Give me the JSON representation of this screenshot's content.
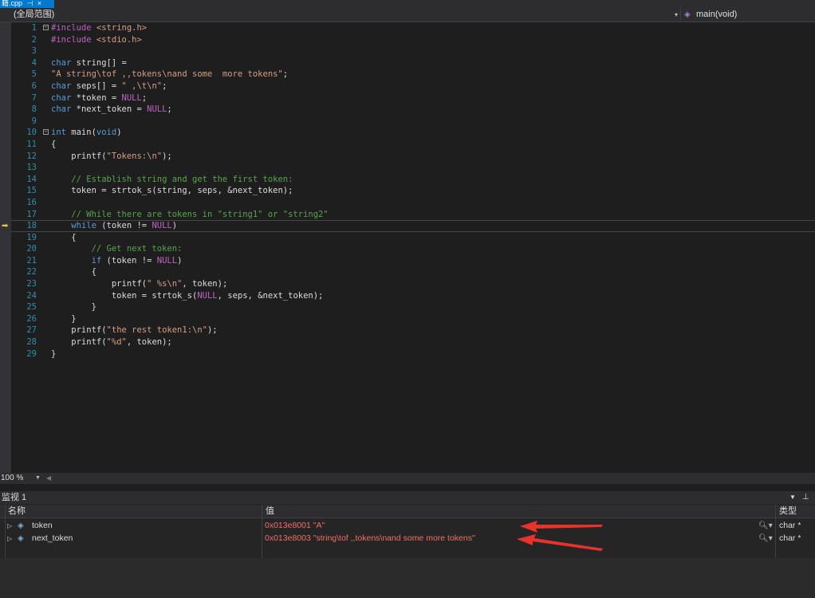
{
  "tab": {
    "label": "籍.cpp",
    "pin": "⊣",
    "close": "×"
  },
  "navbar": {
    "scope": "(全局范围)",
    "member": "main(void)"
  },
  "code": [
    {
      "n": "1",
      "fold": "−",
      "parts": [
        {
          "c": "mac",
          "t": "#include "
        },
        {
          "c": "str",
          "t": "<string.h>"
        }
      ]
    },
    {
      "n": "2",
      "parts": [
        {
          "c": "mac",
          "t": "#include "
        },
        {
          "c": "str",
          "t": "<stdio.h>"
        }
      ]
    },
    {
      "n": "3",
      "parts": []
    },
    {
      "n": "4",
      "parts": [
        {
          "c": "kw",
          "t": "char"
        },
        {
          "c": "",
          "t": " string[] ="
        }
      ]
    },
    {
      "n": "5",
      "parts": [
        {
          "c": "str",
          "t": "\"A string\\tof ,,tokens\\nand some  more tokens\""
        },
        {
          "c": "",
          "t": ";"
        }
      ]
    },
    {
      "n": "6",
      "parts": [
        {
          "c": "kw",
          "t": "char"
        },
        {
          "c": "",
          "t": " seps[] = "
        },
        {
          "c": "str",
          "t": "\" ,\\t\\n\""
        },
        {
          "c": "",
          "t": ";"
        }
      ]
    },
    {
      "n": "7",
      "parts": [
        {
          "c": "kw",
          "t": "char"
        },
        {
          "c": "",
          "t": " *token = "
        },
        {
          "c": "mac",
          "t": "NULL"
        },
        {
          "c": "",
          "t": ";"
        }
      ]
    },
    {
      "n": "8",
      "parts": [
        {
          "c": "kw",
          "t": "char"
        },
        {
          "c": "",
          "t": " *next_token = "
        },
        {
          "c": "mac",
          "t": "NULL"
        },
        {
          "c": "",
          "t": ";"
        }
      ]
    },
    {
      "n": "9",
      "parts": []
    },
    {
      "n": "10",
      "fold": "−",
      "parts": [
        {
          "c": "kw",
          "t": "int"
        },
        {
          "c": "",
          "t": " main("
        },
        {
          "c": "kw",
          "t": "void"
        },
        {
          "c": "",
          "t": ")"
        }
      ]
    },
    {
      "n": "11",
      "parts": [
        {
          "c": "",
          "t": "{"
        }
      ]
    },
    {
      "n": "12",
      "parts": [
        {
          "c": "",
          "t": "    printf("
        },
        {
          "c": "str",
          "t": "\"Tokens:\\n\""
        },
        {
          "c": "",
          "t": ");"
        }
      ]
    },
    {
      "n": "13",
      "parts": []
    },
    {
      "n": "14",
      "parts": [
        {
          "c": "cm",
          "t": "    // Establish string and get the first token:"
        }
      ]
    },
    {
      "n": "15",
      "parts": [
        {
          "c": "",
          "t": "    token = strtok_s(string, seps, &next_token);"
        }
      ]
    },
    {
      "n": "16",
      "parts": []
    },
    {
      "n": "17",
      "parts": [
        {
          "c": "cm",
          "t": "    // While there are tokens in \"string1\" or \"string2\""
        }
      ]
    },
    {
      "n": "18",
      "current": true,
      "parts": [
        {
          "c": "",
          "t": "    "
        },
        {
          "c": "kw",
          "t": "while"
        },
        {
          "c": "",
          "t": " (token != "
        },
        {
          "c": "mac",
          "t": "NULL"
        },
        {
          "c": "",
          "t": ")"
        }
      ]
    },
    {
      "n": "19",
      "parts": [
        {
          "c": "",
          "t": "    {"
        }
      ]
    },
    {
      "n": "20",
      "parts": [
        {
          "c": "cm",
          "t": "        // Get next token:"
        }
      ]
    },
    {
      "n": "21",
      "parts": [
        {
          "c": "",
          "t": "        "
        },
        {
          "c": "kw",
          "t": "if"
        },
        {
          "c": "",
          "t": " (token != "
        },
        {
          "c": "mac",
          "t": "NULL"
        },
        {
          "c": "",
          "t": ")"
        }
      ]
    },
    {
      "n": "22",
      "parts": [
        {
          "c": "",
          "t": "        {"
        }
      ]
    },
    {
      "n": "23",
      "parts": [
        {
          "c": "",
          "t": "            printf("
        },
        {
          "c": "str",
          "t": "\" %s\\n\""
        },
        {
          "c": "",
          "t": ", token);"
        }
      ]
    },
    {
      "n": "24",
      "parts": [
        {
          "c": "",
          "t": "            token = strtok_s("
        },
        {
          "c": "mac",
          "t": "NULL"
        },
        {
          "c": "",
          "t": ", seps, &next_token);"
        }
      ]
    },
    {
      "n": "25",
      "parts": [
        {
          "c": "",
          "t": "        }"
        }
      ]
    },
    {
      "n": "26",
      "parts": [
        {
          "c": "",
          "t": "    }"
        }
      ]
    },
    {
      "n": "27",
      "parts": [
        {
          "c": "",
          "t": "    printf("
        },
        {
          "c": "str",
          "t": "\"the rest token1:\\n\""
        },
        {
          "c": "",
          "t": ");"
        }
      ]
    },
    {
      "n": "28",
      "parts": [
        {
          "c": "",
          "t": "    printf("
        },
        {
          "c": "str",
          "t": "\"%d\""
        },
        {
          "c": "",
          "t": ", token);"
        }
      ]
    },
    {
      "n": "29",
      "parts": [
        {
          "c": "",
          "t": "}"
        }
      ]
    }
  ],
  "zoom": {
    "value": "100 %"
  },
  "watch": {
    "title": "监视 1",
    "headers": {
      "name": "名称",
      "value": "值",
      "type": "类型"
    },
    "rows": [
      {
        "name": "token",
        "value": "0x013e8001 \"A\"",
        "type": "char *"
      },
      {
        "name": "next_token",
        "value": "0x013e8003 \"string\\tof ,,tokens\\nand some  more tokens\"",
        "type": "char *"
      }
    ]
  },
  "colors": {
    "accent": "#007acc",
    "error_value": "#f07060",
    "arrow": "#e8332a"
  }
}
